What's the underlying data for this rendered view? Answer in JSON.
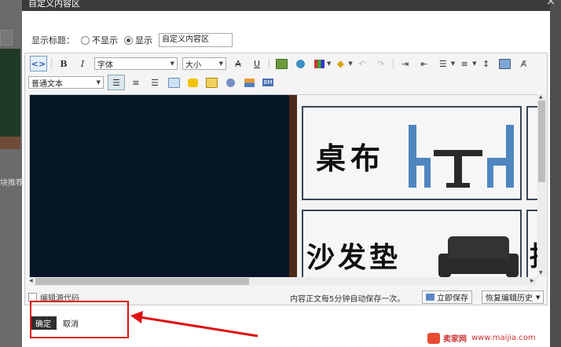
{
  "dialog": {
    "title": "自定义内容区",
    "close_glyph": "×"
  },
  "display_title": {
    "label": "显示标题：",
    "option_hide": "不显示",
    "option_show": "显示",
    "selected": "显示",
    "title_value": "自定义内容区"
  },
  "toolbar": {
    "font_family": "字体",
    "font_size": "大小",
    "paragraph_format": "普通文本",
    "icons_row1": [
      "source-code-icon",
      "bold-icon",
      "italic-icon",
      "strikethrough-icon",
      "underline-icon",
      "insert-image-icon",
      "insert-link-icon",
      "text-color-icon",
      "highlight-color-icon",
      "undo-icon",
      "redo-icon",
      "indent-icon",
      "outdent-icon",
      "unordered-list-icon",
      "ordered-list-icon",
      "line-height-icon",
      "insert-video-icon",
      "clear-format-icon"
    ],
    "icons_row2": [
      "align-left-icon",
      "align-center-icon",
      "align-right-icon",
      "insert-table-icon",
      "emoticon-icon",
      "insert-flash-icon",
      "insert-hr-icon",
      "insert-module-icon",
      "bm-icon"
    ],
    "bm_text": "BM"
  },
  "content": {
    "card1_text": "桌布",
    "card2_text": "沙发垫",
    "card3_text": "抱",
    "colors": {
      "dark_panel": "#071627",
      "wood": "#4e2a1a",
      "chair_blue": "#4f86c0"
    }
  },
  "footer": {
    "edit_source_label": "编辑源代码",
    "autosave_text": "内容正文每5分钟自动保存一次。",
    "save_now": "立即保存",
    "restore_history": "恢复编辑历史"
  },
  "actions": {
    "confirm": "确定",
    "cancel": "取消"
  },
  "watermark": {
    "brand": "卖家网",
    "url": "www.maijia.com"
  },
  "background": {
    "side_text": "块推荐"
  }
}
